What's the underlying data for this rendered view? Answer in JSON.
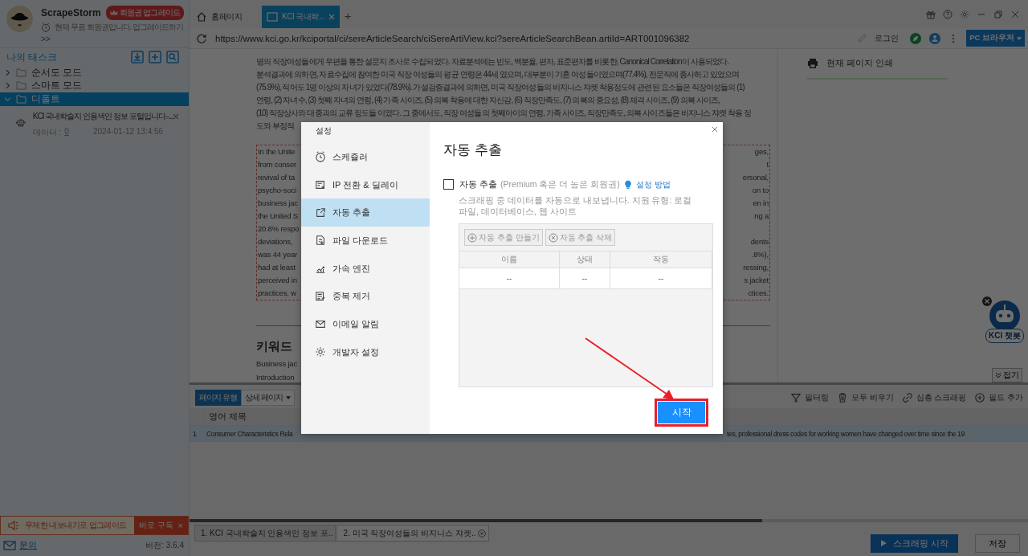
{
  "app": {
    "name": "ScrapeStorm",
    "upgrade_badge": "회원권 업그레이드",
    "membership_note": "현재 무료 회원권입니다. 업그레이드하기",
    "expand": ">>"
  },
  "tasks": {
    "title": "나의 태스크",
    "folders": [
      {
        "label": "순서도 모드",
        "expanded": false,
        "selected": false
      },
      {
        "label": "스마트 모드",
        "expanded": false,
        "selected": false
      },
      {
        "label": "디폴트",
        "expanded": true,
        "selected": true,
        "children": [
          {
            "title": "KCI 국내학술지 인용색인 정보 포털입니다.-...",
            "data_label": "데이터 :",
            "data_count": "0",
            "time": "2024-01-12 13:4:56"
          }
        ]
      }
    ]
  },
  "promo": {
    "text": "무제한 내보내기로 업그레이드",
    "action": "바로 구독",
    "close": "×"
  },
  "footer": {
    "contact": "문의",
    "version": "버전: 3.6.4"
  },
  "browser": {
    "tabs": [
      {
        "label": "홈페이지",
        "selected": false,
        "kind": "home"
      },
      {
        "label": "KCI 국내학...",
        "selected": true,
        "kind": "page"
      }
    ],
    "new_tab": "+",
    "url": "https://www.kci.go.kr/kciportal/ci/sereArticleSearch/ciSereArtiView.kci?sereArticleSearchBean.artiId=ART001096382",
    "login": "로그인",
    "mode": "PC 브라우저"
  },
  "article": {
    "korean_lines": [
      "명의 직장여성들에게 우편을 통한 설문지 조사로 수집되었다. 자료분석에는 빈도, 백분율, 편차, 표준편차를 비롯한, Canonical Correlation이 사용되었다.",
      "분석결과에 의하면, 자료수집에 참여한 미국 직장 여성들의 평균 연령은 44세 였으며, 대부분이 기혼 여성들이였으며(77.4%), 전문직에 종사하고 있었으며",
      "(75.9%), 적어도 1명 이상의 자녀가 있었다(78.9%). 가설검증결과에 의하면, 미국 직장여성들의 비지니스 쟈켓 착용정도에 관련된 요소들은 직장여성들의 (1)",
      "연령, (2) 자녀수, (3) 첫째 자녀의 연령, (4) 가족 사이즈, (5) 의복 착용에 대한 자신감, (6) 직장만족도, (7) 의복의 중요성, (8) 체격 사이즈, (9) 의복 사이즈,",
      "(10) 직장상사와 대중과의 교류 정도들 이였다. 그 중에서도, 직장 여성들의 첫째아이의 연령, 가족 사이즈, 직장만족도, 의복 사이즈들은 비지니스 쟈켓 착용 정",
      "도와 부정적"
    ],
    "english_lines": [
      {
        "left": "In the Unite",
        "right": "ges,"
      },
      {
        "left": "from conser",
        "right": "t"
      },
      {
        "left": "revival of ta",
        "right": "ersonal,"
      },
      {
        "left": "psycho-soci",
        "right": "on to"
      },
      {
        "left": "business jac",
        "right": "en in"
      },
      {
        "left": "the United S",
        "right": "ng a"
      },
      {
        "left": "20.8% respo"
      },
      {
        "left": "deviations,",
        "right": "dents"
      },
      {
        "left": "was 44 year",
        "right": ".8%),"
      },
      {
        "left": "had at least",
        "right": "ressing,"
      },
      {
        "left": "perceived in",
        "right": "s jacket"
      },
      {
        "left": "practices, w",
        "right": "ctices."
      }
    ],
    "keywords_heading": "키워드",
    "keyword_lines": [
      "Business jac",
      "Introduction"
    ]
  },
  "side_panel": {
    "print": "현재 페이지 인쇄"
  },
  "chatbot": {
    "label": "KCI 챗봇"
  },
  "collapse": "접기",
  "data_panel": {
    "page_type_label": "페이지 유형",
    "page_type": "상세 페이지",
    "actions": [
      "필터링",
      "모두 비우기",
      "심층 스크래핑",
      "필드 추가"
    ],
    "column": "영어 제목",
    "rows": [
      {
        "number": "1",
        "left": "Consumer Characteristics Rela",
        "right": "tes, professional dress codes for working women have changed over time since the 19",
        "selected": true
      }
    ]
  },
  "page_tabs": [
    {
      "label": "1. KCI 국내학술지 인용색인 정보 포..",
      "selected": false
    },
    {
      "label": "2. 미국 직장여성들의 비지니스 쟈켓..",
      "selected": true
    }
  ],
  "bottom_buttons": {
    "start": "스크래핑 시작",
    "save": "저장"
  },
  "dialog": {
    "title": "설정",
    "nav": [
      {
        "label": "스케쥴러",
        "selected": false
      },
      {
        "label": "IP 전환 & 딜레이",
        "selected": false
      },
      {
        "label": "자동 추출",
        "selected": true
      },
      {
        "label": "파일 다운로드",
        "selected": false
      },
      {
        "label": "가속 엔진",
        "selected": false
      },
      {
        "label": "중복 제거",
        "selected": false
      },
      {
        "label": "이메일 알림",
        "selected": false
      },
      {
        "label": "개발자 설정",
        "selected": false
      }
    ],
    "heading": "자동 추출",
    "option": {
      "label": "자동 추출",
      "note": "(Premium 혹은 더 높은 회원권)",
      "link": "설정 방법",
      "checked": false
    },
    "description": "스크래핑 중 데이터를 자동으로 내보냅니다. 지원 유형: 로컬 파일, 데이터베이스, 웹 사이트",
    "tools": [
      "자동 추출 만들기",
      "자동 추출 삭제"
    ],
    "columns": [
      "이름",
      "상태",
      "작동"
    ],
    "rows": [
      [
        "--",
        "--",
        "--"
      ]
    ],
    "start": "시작"
  }
}
